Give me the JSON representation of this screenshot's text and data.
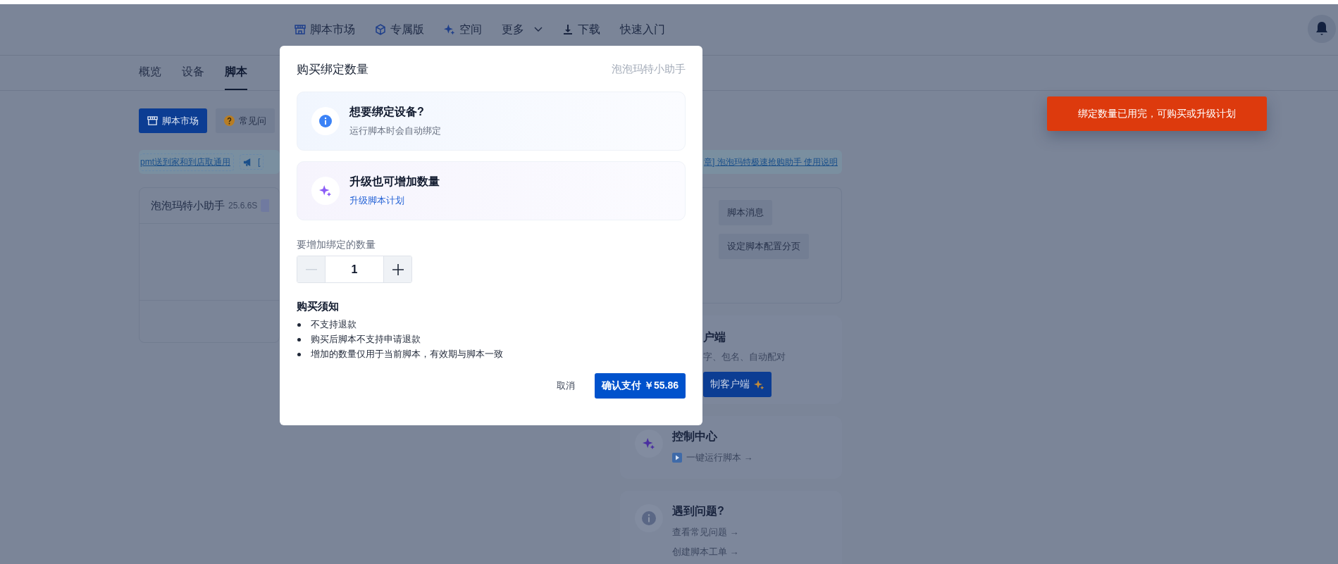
{
  "top_nav": {
    "items": [
      {
        "label": "脚本市场"
      },
      {
        "label": "专属版"
      },
      {
        "label": "空间"
      },
      {
        "label": "更多"
      },
      {
        "label": "下载"
      },
      {
        "label": "快速入门"
      }
    ]
  },
  "tabs": [
    {
      "label": "概览",
      "selected": false
    },
    {
      "label": "设备",
      "selected": false
    },
    {
      "label": "脚本",
      "selected": true
    }
  ],
  "toolbar": {
    "buttons": [
      {
        "label": "脚本市场",
        "primary": true
      },
      {
        "label": "常见问",
        "primary": false
      }
    ]
  },
  "announcement_links": {
    "left": [
      "pmt送到家和到店取通用",
      "["
    ],
    "right": "章] 泡泡玛特极速抢购助手 使用说明"
  },
  "script_card": {
    "name": "泡泡玛特小助手",
    "version": "25.6.6S",
    "actions": [
      "脚本消息",
      "设定脚本配置分页"
    ]
  },
  "client_card": {
    "title": "户端",
    "description": "字、包名、自动配对",
    "button": "制客户端"
  },
  "control_center": {
    "title": "控制中心",
    "link": "一键运行脚本 →"
  },
  "help_card": {
    "title": "遇到问题?",
    "links": [
      "查看常见问题 →",
      "创建脚本工单 →"
    ]
  },
  "toast": {
    "message": "绑定数量已用完，可购买或升级计划"
  },
  "dialog": {
    "title": "购买绑定数量",
    "script_name": "泡泡玛特小助手",
    "tips": [
      {
        "kind": "info",
        "title": "想要绑定设备?",
        "text": "运行脚本时会自动绑定"
      },
      {
        "kind": "upgrade",
        "title": "升级也可增加数量",
        "link": "升级脚本计划"
      }
    ],
    "quantity": {
      "label": "要增加绑定的数量",
      "value": "1",
      "decrement_disabled": true
    },
    "notice": {
      "title": "购买须知",
      "items": [
        "不支持退款",
        "购买后脚本不支持申请退款",
        "增加的数量仅用于当前脚本，有效期与脚本一致"
      ]
    },
    "buttons": {
      "cancel": "取消",
      "confirm": "确认支付 ￥55.86"
    }
  }
}
